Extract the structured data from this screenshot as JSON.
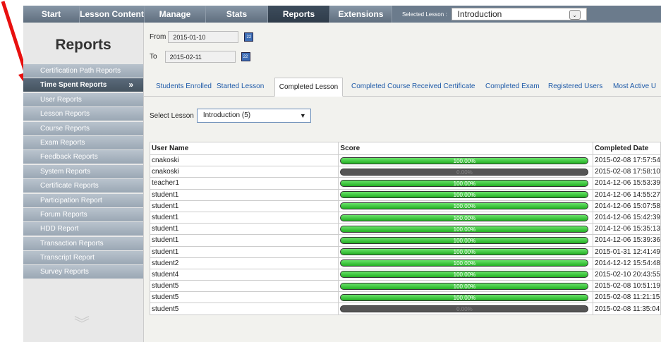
{
  "topnav": {
    "items": [
      "Start",
      "Lesson Content",
      "Manage",
      "Stats",
      "Reports",
      "Extensions"
    ],
    "active": "Reports",
    "selected_lesson_label": "Selected Lesson :",
    "selected_lesson_value": "Introduction"
  },
  "sidebar": {
    "title": "Reports",
    "items": [
      "Certification Path Reports",
      "Time Spent Reports",
      "User Reports",
      "Lesson Reports",
      "Course Reports",
      "Exam Reports",
      "Feedback Reports",
      "System Reports",
      "Certificate Reports",
      "Participation Report",
      "Forum Reports",
      "HDD Report",
      "Transaction Reports",
      "Transcript Report",
      "Survey Reports"
    ],
    "active_index": 1,
    "active_chevron": "»",
    "bottom_icon": "double-chevron-down-icon"
  },
  "filters": {
    "from_label": "From",
    "from_value": "2015-01-10",
    "to_label": "To",
    "to_value": "2015-02-11",
    "calendar_icon": "calendar-icon"
  },
  "tabs": [
    "Students Enrolled",
    "Started Lesson",
    "Completed Lesson",
    "Completed Course",
    "Received Certificate",
    "Completed Exam",
    "Registered Users",
    "Most Active U"
  ],
  "active_tab": "Completed Lesson",
  "lesson_select": {
    "label": "Select Lesson",
    "value": "Introduction (5)"
  },
  "table": {
    "headers": [
      "User Name",
      "Score",
      "Completed Date"
    ],
    "rows": [
      {
        "user": "cnakoski",
        "score": 100,
        "score_label": "100.00%",
        "date": "2015-02-08 17:57:54"
      },
      {
        "user": "cnakoski",
        "score": 0,
        "score_label": "0.00%",
        "date": "2015-02-08 17:58:10"
      },
      {
        "user": "teacher1",
        "score": 100,
        "score_label": "100.00%",
        "date": "2014-12-06 15:53:39"
      },
      {
        "user": "student1",
        "score": 100,
        "score_label": "100.00%",
        "date": "2014-12-06 14:55:27"
      },
      {
        "user": "student1",
        "score": 100,
        "score_label": "100.00%",
        "date": "2014-12-06 15:07:58"
      },
      {
        "user": "student1",
        "score": 100,
        "score_label": "100.00%",
        "date": "2014-12-06 15:42:39"
      },
      {
        "user": "student1",
        "score": 100,
        "score_label": "100.00%",
        "date": "2014-12-06 15:35:13"
      },
      {
        "user": "student1",
        "score": 100,
        "score_label": "100.00%",
        "date": "2014-12-06 15:39:36"
      },
      {
        "user": "student1",
        "score": 100,
        "score_label": "100.00%",
        "date": "2015-01-31 12:41:49"
      },
      {
        "user": "student2",
        "score": 100,
        "score_label": "100.00%",
        "date": "2014-12-12 15:54:48"
      },
      {
        "user": "student4",
        "score": 100,
        "score_label": "100.00%",
        "date": "2015-02-10 20:43:55"
      },
      {
        "user": "student5",
        "score": 100,
        "score_label": "100.00%",
        "date": "2015-02-08 10:51:19"
      },
      {
        "user": "student5",
        "score": 100,
        "score_label": "100.00%",
        "date": "2015-02-08 11:21:15"
      },
      {
        "user": "student5",
        "score": 0,
        "score_label": "0.00%",
        "date": "2015-02-08 11:35:04"
      }
    ]
  },
  "colors": {
    "nav_bg": "#6b7b8c",
    "progress_green": "#23b023",
    "link_blue": "#1e5aa8",
    "annotation_arrow": "#e8100f"
  }
}
